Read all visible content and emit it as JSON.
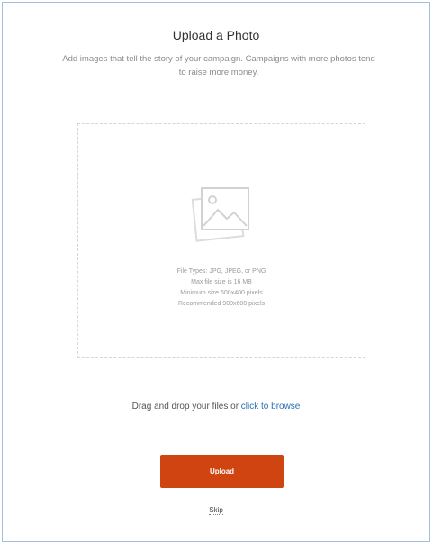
{
  "page": {
    "title": "Upload a Photo",
    "subtitle_line1": "Add images that tell the story of your campaign. Campaigns with more photos tend",
    "subtitle_line2": "to raise more money."
  },
  "dropzone": {
    "icon": "image-icon",
    "file_types": "File Types: JPG, JPEG, or PNG",
    "max_size": "Max file size is 16 MB",
    "min_size": "Minimum size 600x400 pixels",
    "recommended_size": "Recommended 900x600 pixels"
  },
  "drag_drop": {
    "text": "Drag and drop your files or ",
    "browse_link": "click to browse"
  },
  "actions": {
    "upload_label": "Upload",
    "skip_label": "Skip"
  },
  "colors": {
    "accent": "#cf4411",
    "link": "#2a6fb5"
  }
}
